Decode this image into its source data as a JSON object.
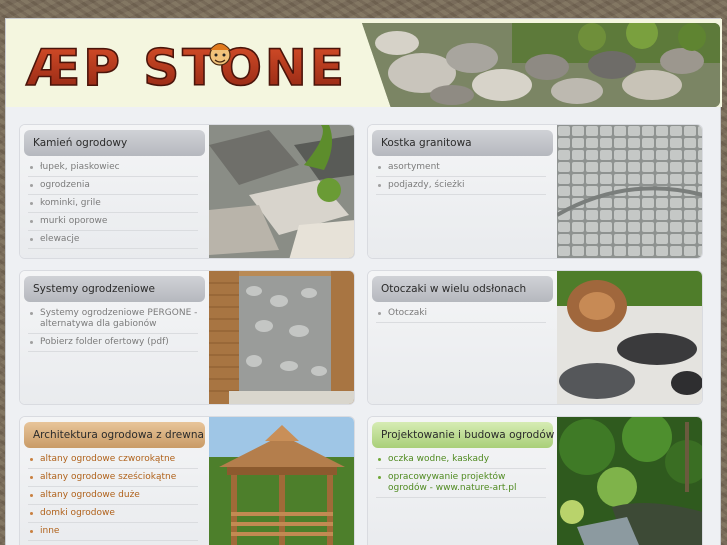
{
  "brand": {
    "logo_text": "ÆP STONE"
  },
  "cards": [
    {
      "title": "Kamień ogrodowy",
      "items": [
        "łupek, piaskowiec",
        "ogrodzenia",
        "kominki, grile",
        "murki oporowe",
        "elewacje"
      ]
    },
    {
      "title": "Kostka granitowa",
      "items": [
        "asortyment",
        "podjazdy, ścieżki"
      ]
    },
    {
      "title": "Systemy ogrodzeniowe",
      "items": [
        "Systemy ogrodzeniowe PERGONE - alternatywa dla gabionów",
        "Pobierz folder ofertowy (pdf)"
      ]
    },
    {
      "title": "Otoczaki w wielu odsłonach",
      "items": [
        "Otoczaki"
      ]
    },
    {
      "title": "Architektura ogrodowa z drewna",
      "items": [
        "altany ogrodowe czworokątne",
        "altany ogrodowe sześciokątne",
        "altany ogrodowe duże",
        "domki ogrodowe",
        "inne"
      ]
    },
    {
      "title": "Projektowanie i budowa ogrodów",
      "items": [
        "oczka wodne, kaskady",
        "opracowywanie projektów ogrodów - www.nature-art.pl"
      ]
    }
  ],
  "colors": {
    "wood_accent": "#c99b66",
    "green_accent": "#a9cf78",
    "logo_red": "#b8321c"
  }
}
